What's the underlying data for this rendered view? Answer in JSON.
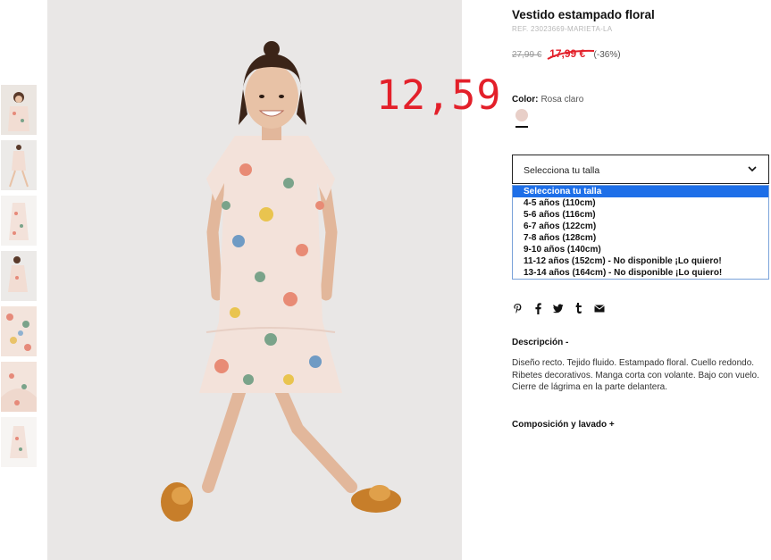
{
  "product": {
    "title": "Vestido estampado floral",
    "ref": "REF. 23023669-MARIETA-LA",
    "old_price": "27,99 €",
    "sale_price": "17,99 €",
    "discount": "(-36%)",
    "overlay_price": "12,59"
  },
  "color": {
    "label": "Color:",
    "value": "Rosa claro",
    "swatch_hex": "#e8cfc8"
  },
  "size": {
    "select_label": "Selecciona tu talla",
    "options": [
      "Selecciona tu talla",
      "4-5 años (110cm)",
      "5-6 años (116cm)",
      "6-7 años (122cm)",
      "7-8 años (128cm)",
      "9-10 años (140cm)",
      "11-12 años (152cm) - No disponible ¡Lo quiero!",
      "13-14 años (164cm) - No disponible ¡Lo quiero!"
    ],
    "selected_index": 0
  },
  "share_icons": [
    "pinterest-icon",
    "facebook-icon",
    "twitter-icon",
    "tumblr-icon",
    "email-icon"
  ],
  "description": {
    "heading": "Descripción -",
    "text": "Diseño recto. Tejido fluido. Estampado floral. Cuello redondo. Ribetes decorativos. Manga corta con volante. Bajo con vuelo. Cierre de lágrima en la parte delantera."
  },
  "composition": {
    "heading": "Composición y lavado +"
  },
  "colors": {
    "accent_red": "#e3202a",
    "select_highlight": "#1e6fe8"
  }
}
